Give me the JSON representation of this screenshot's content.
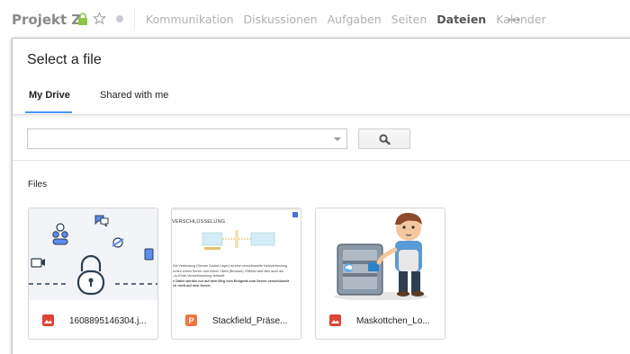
{
  "project": {
    "title": "Projekt Z",
    "nav": [
      "Kommunikation",
      "Diskussionen",
      "Aufgaben",
      "Seiten",
      "Dateien",
      "Kalender"
    ],
    "active_nav": "Dateien"
  },
  "dialog": {
    "title": "Select a file",
    "tabs": [
      {
        "label": "My Drive",
        "active": true
      },
      {
        "label": "Shared with me",
        "active": false
      }
    ],
    "search": {
      "value": "",
      "placeholder": ""
    },
    "section_label": "Files",
    "files": [
      {
        "name": "1608895146304.j...",
        "type": "image-icon",
        "type_color": "#db4437"
      },
      {
        "name": "Stackfield_Präse...",
        "type": "presentation-icon",
        "type_color": "#f0753f"
      },
      {
        "name": "Maskottchen_Lo...",
        "type": "image-icon",
        "type_color": "#db4437"
      }
    ],
    "slide_preview": {
      "heading": "VERSCHLÜSSELUNG",
      "lines": [
        "Die Verbindung (Secure Socket Layer) ist eine verschlüsselte Netzverbindung",
        "schen einem Server und einem Client (Browser). Effektiv wird dies auch als",
        "-zu-Ende-Verschlüsselung verkauft.",
        "e Daten werden nur auf dem Weg vom Endgerät zum Server verschlüsselt",
        "ch nicht auf dem Server."
      ]
    }
  },
  "colors": {
    "accent": "#4d90fe",
    "secure_green": "#5cb85c"
  }
}
